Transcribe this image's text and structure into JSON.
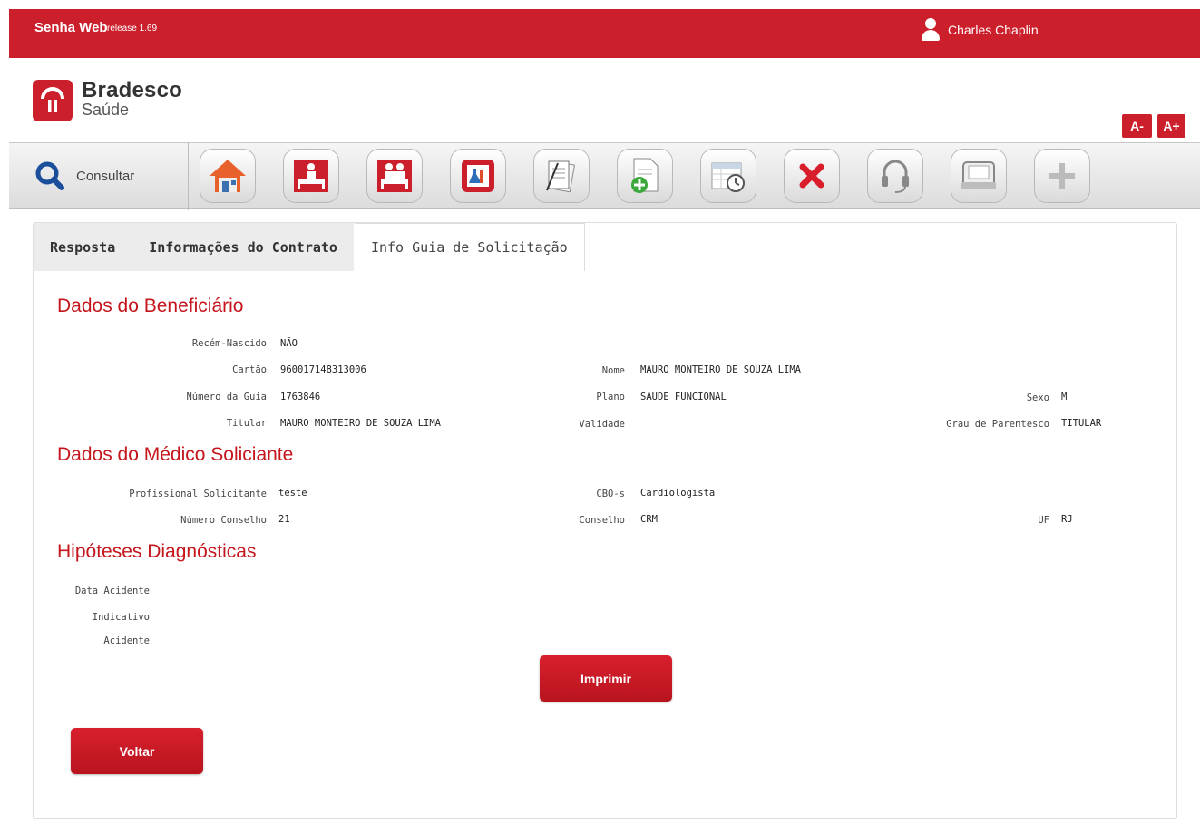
{
  "header": {
    "app_name": "Senha Web",
    "release": "release 1.69",
    "user_name": "Charles Chaplin"
  },
  "logo": {
    "line1": "Bradesco",
    "line2": "Saúde"
  },
  "font_size": {
    "decrease_label": "A-",
    "increase_label": "A+"
  },
  "toolbar": {
    "consult_label": "Consultar",
    "icons": [
      "home-icon",
      "inpatient-icon",
      "inpatient-couple-icon",
      "lab-exam-icon",
      "documents-icon",
      "add-document-icon",
      "schedule-icon",
      "cancel-icon",
      "support-headset-icon",
      "printer-icon",
      "plus-icon"
    ]
  },
  "tabs": [
    {
      "label": "Resposta"
    },
    {
      "label": "Informações do Contrato"
    },
    {
      "label": "Info Guia de Solicitação"
    }
  ],
  "beneficiario": {
    "title": "Dados do Beneficiário",
    "recem_nascido_label": "Recém-Nascido",
    "recem_nascido_value": "NÃO",
    "cartao_label": "Cartão",
    "cartao_value": "960017148313006",
    "numero_guia_label": "Número da Guia",
    "numero_guia_value": "1763846",
    "titular_label": "Titular",
    "titular_value": "MAURO MONTEIRO DE SOUZA LIMA",
    "nome_label": "Nome",
    "nome_value": "MAURO MONTEIRO DE SOUZA LIMA",
    "plano_label": "Plano",
    "plano_value": "SAUDE FUNCIONAL",
    "validade_label": "Validade",
    "sexo_label": "Sexo",
    "sexo_value": "M",
    "grau_label": "Grau de Parentesco",
    "grau_value": "TITULAR"
  },
  "medico": {
    "title": "Dados do Médico Soliciante",
    "profissional_label": "Profissional Solicitante",
    "profissional_value": "teste",
    "numero_conselho_label": "Número Conselho",
    "numero_conselho_value": "21",
    "cbo_label": "CBO-s",
    "cbo_value": "Cardiologista",
    "conselho_label": "Conselho",
    "conselho_value": "CRM",
    "uf_label": "UF",
    "uf_value": "RJ"
  },
  "hipoteses": {
    "title": "Hipóteses Diagnósticas",
    "data_acidente_label": "Data Acidente",
    "indicativo_label": "Indicativo",
    "acidente_label": "Acidente"
  },
  "actions": {
    "print_label": "Imprimir",
    "back_label": "Voltar"
  },
  "colors": {
    "brand_red": "#cc1f2c",
    "title_red": "#c4161c"
  }
}
